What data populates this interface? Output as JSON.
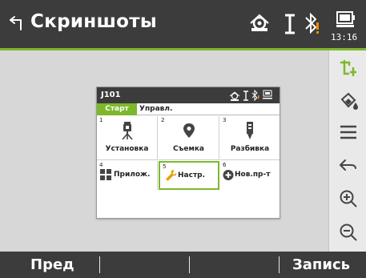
{
  "window": {
    "title": "Скриншоты",
    "clock": "13:16"
  },
  "toolbar": {
    "items": [
      "crop-icon",
      "fill-icon",
      "menu-icon",
      "back-arrow-icon",
      "zoom-in-icon",
      "zoom-out-icon"
    ]
  },
  "thumbnail": {
    "title": "J101",
    "tabs": {
      "active": "Старт",
      "other": "Управл."
    },
    "tiles": [
      {
        "num": "1",
        "label": "Установка",
        "icon": "instrument-icon"
      },
      {
        "num": "2",
        "label": "Съемка",
        "icon": "location-pin-icon"
      },
      {
        "num": "3",
        "label": "Разбивка",
        "icon": "stakeout-icon"
      },
      {
        "num": "4",
        "label": "Прилож.",
        "icon": "apps-icon"
      },
      {
        "num": "5",
        "label": "Настр.",
        "icon": "wrench-icon"
      },
      {
        "num": "6",
        "label": "Нов.пр-т",
        "icon": "new-project-icon"
      }
    ],
    "selected_tile": "5"
  },
  "softkeys": {
    "f1": "Пред",
    "f2": "",
    "f3": "",
    "f4": "Запись"
  },
  "colors": {
    "accent": "#7db82b",
    "bar": "#3c3c3c",
    "background": "#d7d7d7",
    "warning": "#f08c00"
  }
}
